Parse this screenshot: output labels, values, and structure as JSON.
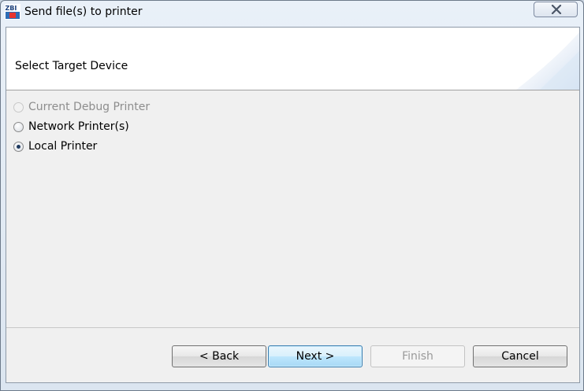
{
  "window": {
    "title": "Send file(s) to printer",
    "icon_text": "ZBI"
  },
  "header": {
    "title": "Select Target Device"
  },
  "options": [
    {
      "label": "Current Debug Printer",
      "checked": false,
      "enabled": false
    },
    {
      "label": "Network Printer(s)",
      "checked": false,
      "enabled": true
    },
    {
      "label": "Local Printer",
      "checked": true,
      "enabled": true
    }
  ],
  "buttons": {
    "back": "< Back",
    "next": "Next >",
    "finish": "Finish",
    "cancel": "Cancel"
  },
  "colors": {
    "accent": "#3c7fb1",
    "panel": "#f0f0f0",
    "disabled_text": "#8d8d8d"
  },
  "icons": [
    "zbi-app-icon",
    "close-icon"
  ]
}
